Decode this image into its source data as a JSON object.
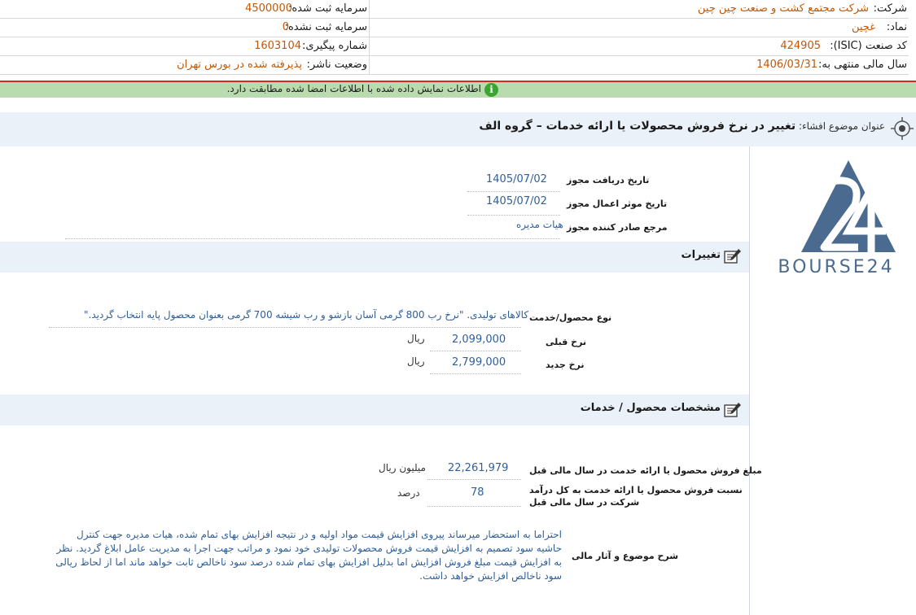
{
  "header": {
    "company_label": "شرکت:",
    "company_value": "شرکت مجتمع کشت و صنعت چین چین",
    "symbol_label": "نماد:",
    "symbol_value": "غچین",
    "isic_label": "کد صنعت (ISIC):",
    "isic_value": "424905",
    "fiscal_label": "سال مالی منتهی به:",
    "fiscal_value": "1406/03/31",
    "capital_reg_label": "سرمایه ثبت شده:",
    "capital_reg_value": "4500000",
    "capital_unreg_label": "سرمایه ثبت نشده:",
    "capital_unreg_value": "0",
    "tracking_label": "شماره پیگیری:",
    "tracking_value": "1603104",
    "status_label": "وضعیت ناشر:",
    "status_value": "پذیرفته شده در بورس تهران"
  },
  "notice": {
    "icon": "info-icon",
    "text": "اطلاعات نمایش داده شده با اطلاعات امضا شده مطابقت دارد."
  },
  "title": {
    "label": "عنوان موضوع افشاء:",
    "value": "تغییر در نرخ فروش محصولات یا ارائه خدمات – گروه الف"
  },
  "permit": {
    "receive_date_label": "تاریخ دریافت مجوز",
    "receive_date_value": "1405/07/02",
    "effective_date_label": "تاریخ موثر اعمال مجوز",
    "effective_date_value": "1405/07/02",
    "issuer_label": "مرجع صادر کننده مجوز",
    "issuer_value": "هیات مدیره"
  },
  "changes": {
    "title": "تغییرات",
    "product_label": "نوع محصول/خدمت",
    "product_value": "کالاهای تولیدی. \"نرخ رب 800 گرمی آسان بازشو و رب شیشه 700 گرمی بعنوان محصول پایه انتخاب گردید.\"",
    "prev_rate_label": "نرخ قبلی",
    "prev_rate_value": "2,099,000",
    "prev_rate_unit": "ریال",
    "new_rate_label": "نرخ جدید",
    "new_rate_value": "2,799,000",
    "new_rate_unit": "ریال"
  },
  "specs": {
    "title": "مشخصات محصول / خدمات",
    "sales_label": "مبلغ فروش محصول یا ارائه خدمت در سال مالی قبل",
    "sales_value": "22,261,979",
    "sales_unit": "میلیون ریال",
    "ratio_label_1": "نسبت فروش محصول یا ارائه خدمت به کل درآمد",
    "ratio_label_2": "شرکت در سال مالی قبل",
    "ratio_value": "78",
    "ratio_unit": "درصد",
    "desc_label": "شرح موضوع و آثار مالی",
    "desc_value": "احتراما به استحضار میرساند پیروی افزایش قیمت مواد اولیه و در نتیجه افزایش بهای تمام شده، هیات مدیره جهت کنترل حاشیه سود تصمیم به افزایش قیمت فروش محصولات تولیدی خود نمود و مراتب جهت اجرا به مدیریت عامل ابلاغ گردید. نظر به افزایش قیمت مبلغ فروش افزایش اما بدلیل افزایش بهای تمام شده درصد سود ناخالص ثابت خواهد ماند اما از لحاظ ریالی سود ناخالص افزایش خواهد داشت."
  },
  "logo": {
    "text": "BOURSE24",
    "color": "#4a6b8f"
  }
}
